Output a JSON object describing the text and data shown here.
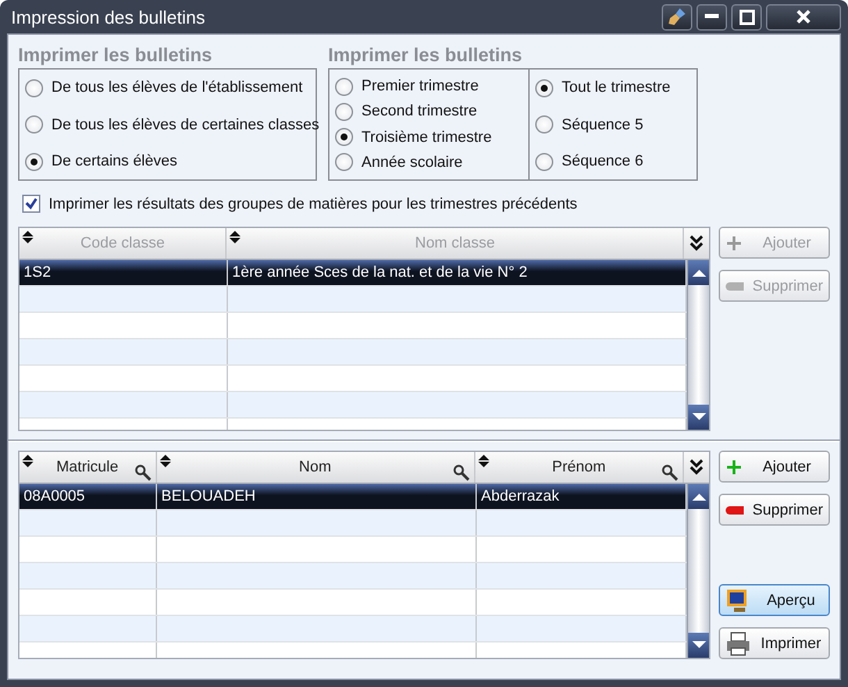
{
  "window": {
    "title": "Impression des bulletins"
  },
  "option_groups": [
    {
      "title": "Imprimer les bulletins",
      "options": [
        {
          "label": "De tous les élèves de l'établissement",
          "selected": false
        },
        {
          "label": "De tous les élèves de certaines classes",
          "selected": false
        },
        {
          "label": "De certains élèves",
          "selected": true
        }
      ]
    },
    {
      "title": "Imprimer les bulletins",
      "options": [
        {
          "label": "Premier trimestre",
          "selected": false
        },
        {
          "label": "Second trimestre",
          "selected": false
        },
        {
          "label": "Troisième trimestre",
          "selected": true
        },
        {
          "label": "Année scolaire",
          "selected": false
        }
      ]
    },
    {
      "options": [
        {
          "label": "Tout le trimestre",
          "selected": true
        },
        {
          "label": "Séquence 5",
          "selected": false
        },
        {
          "label": "Séquence 6",
          "selected": false
        }
      ]
    }
  ],
  "previous_results": {
    "label": "Imprimer les résultats des groupes de matières pour les trimestres précédents",
    "checked": true
  },
  "grids": [
    {
      "columns": [
        {
          "label": "Code classe",
          "key": false
        },
        {
          "label": "Nom classe",
          "key": false
        }
      ],
      "header_disabled": true,
      "rows": [
        {
          "cells": [
            "1S2",
            "1ère année Sces de la nat. et de la vie N° 2"
          ],
          "selected": true
        }
      ],
      "buttons": [
        {
          "kind": "add",
          "label": "Ajouter",
          "disabled": true
        },
        {
          "kind": "remove",
          "label": "Supprimer",
          "disabled": true
        }
      ]
    },
    {
      "columns": [
        {
          "label": "Matricule",
          "key": true
        },
        {
          "label": "Nom",
          "key": true
        },
        {
          "label": "Prénom",
          "key": true
        }
      ],
      "header_disabled": false,
      "rows": [
        {
          "cells": [
            "08A0005",
            "BELOUADEH",
            "Abderrazak"
          ],
          "selected": true
        }
      ],
      "buttons": [
        {
          "kind": "add",
          "label": "Ajouter",
          "disabled": false
        },
        {
          "kind": "remove",
          "label": "Supprimer",
          "disabled": false
        },
        {
          "kind": "preview",
          "label": "Aperçu",
          "disabled": false
        },
        {
          "kind": "print",
          "label": "Imprimer",
          "disabled": false
        }
      ]
    }
  ]
}
